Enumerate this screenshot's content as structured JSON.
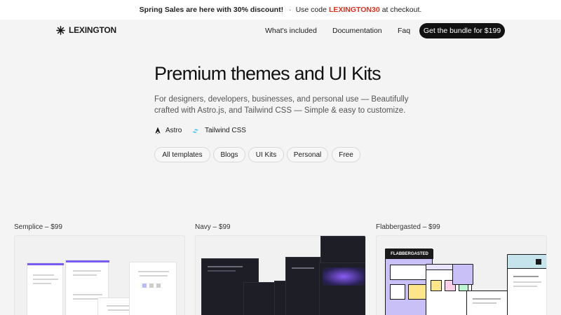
{
  "promo": {
    "headline": "Spring Sales are here with 30% discount!",
    "separator": "·",
    "prefix": "Use code",
    "code": "LEXINGTON30",
    "suffix": "at checkout.",
    "code_color": "#e0301e"
  },
  "nav": {
    "logo_text": "LEXINGTON",
    "links": [
      "What's included",
      "Documentation",
      "Faq"
    ],
    "cta": "Get the bundle for $199"
  },
  "hero": {
    "title": "Premium themes and UI Kits",
    "subtitle": "For designers, developers, businesses, and personal use — Beautifully crafted with Astro.js, and Tailwind CSS — Simple & easy to customize.",
    "tech": [
      {
        "label": "Astro",
        "icon": "astro-icon"
      },
      {
        "label": "Tailwind CSS",
        "icon": "tailwind-icon"
      }
    ]
  },
  "filters": [
    "All templates",
    "Blogs",
    "UI Kits",
    "Personal",
    "Free"
  ],
  "templates": [
    {
      "label": "Semplice – $99"
    },
    {
      "label": "Navy – $99"
    },
    {
      "label": "Flabbergasted – $99",
      "preview_title": "FLABBERGASTED"
    }
  ],
  "colors": {
    "background": "#f4f4f4",
    "cta_background": "#111111",
    "accent_purple": "#7b5cf0",
    "navy_dark": "#1e1f26"
  }
}
